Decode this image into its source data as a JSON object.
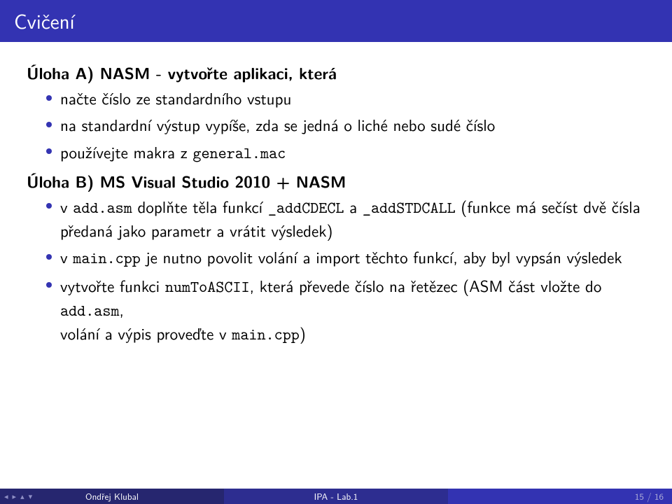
{
  "title": "Cvičení",
  "taskA": {
    "heading": "Úloha A) NASM - vytvořte aplikaci, která",
    "items": [
      "načte číslo ze standardního vstupu",
      "na standardní výstup vypíše, zda se jedná o liché nebo sudé číslo",
      "používejte makra z general.mac"
    ]
  },
  "taskB": {
    "heading": "Úloha B) MS Visual Studio 2010 + NASM",
    "items": [
      {
        "pre": "v ",
        "tt": "add.asm",
        "post": " doplňte těla funkcí ",
        "tt2": "_addCDECL",
        "mid": " a ",
        "tt3": "_addSTDCALL",
        "tail": " (funkce má sečíst dvě čísla předaná jako parametr a vrátit výsledek)"
      },
      {
        "pre": "v ",
        "tt": "main.cpp",
        "post": " je nutno povolit volání a import těchto funkcí, aby byl vypsán výsledek"
      },
      {
        "pre": "vytvořte funkci ",
        "tt": "numToASCII",
        "post": ", která převede číslo na řetězec (ASM část vložte do ",
        "tt2": "add.asm",
        "mid2": ",",
        "br": true,
        "tail2a": "volání a výpis proveďte v ",
        "tt_tail": "main.cpp",
        "tail2b": ")"
      }
    ]
  },
  "footer": {
    "author": "Ondřej Klubal",
    "middle": "IPA - Lab.1",
    "page": "15 / 16"
  }
}
